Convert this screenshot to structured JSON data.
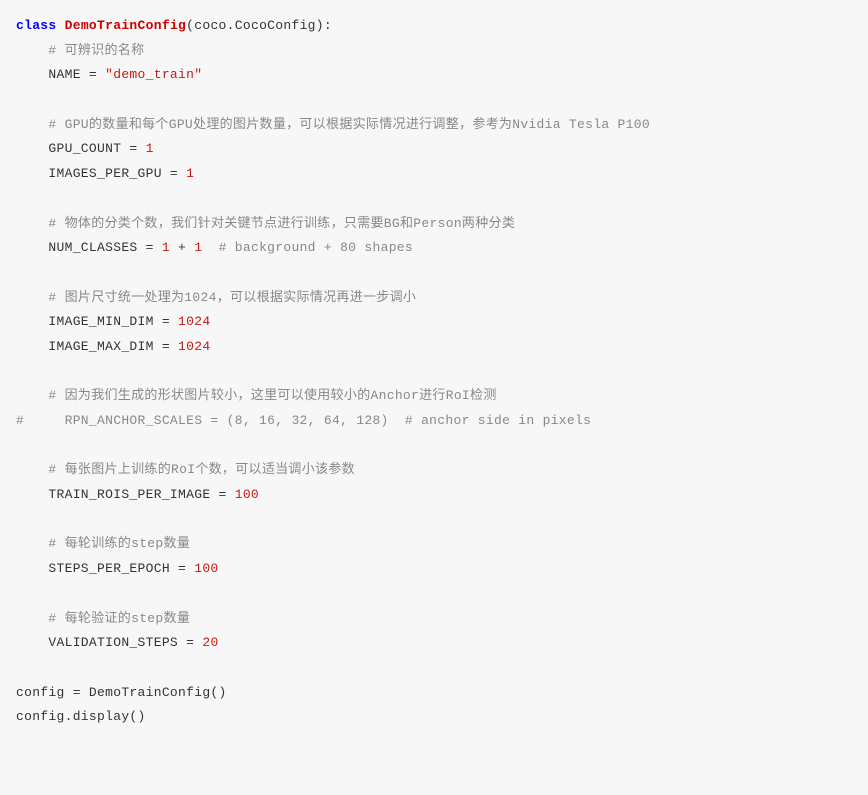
{
  "lines": [
    {
      "tokens": [
        {
          "cls": "kw",
          "text": "class"
        },
        {
          "cls": "ident",
          "text": " "
        },
        {
          "cls": "cls",
          "text": "DemoTrainConfig"
        },
        {
          "cls": "paren",
          "text": "(coco.CocoConfig):"
        }
      ]
    },
    {
      "tokens": [
        {
          "cls": "ident",
          "text": "    "
        },
        {
          "cls": "comment",
          "text": "# 可辨识的名称"
        }
      ]
    },
    {
      "tokens": [
        {
          "cls": "ident",
          "text": "    NAME = "
        },
        {
          "cls": "str",
          "text": "\"demo_train\""
        }
      ]
    },
    {
      "blank": true
    },
    {
      "tokens": [
        {
          "cls": "ident",
          "text": "    "
        },
        {
          "cls": "comment",
          "text": "# GPU的数量和每个GPU处理的图片数量，可以根据实际情况进行调整，参考为Nvidia Tesla P100"
        }
      ]
    },
    {
      "tokens": [
        {
          "cls": "ident",
          "text": "    GPU_COUNT = "
        },
        {
          "cls": "num",
          "text": "1"
        }
      ]
    },
    {
      "tokens": [
        {
          "cls": "ident",
          "text": "    IMAGES_PER_GPU = "
        },
        {
          "cls": "num",
          "text": "1"
        }
      ]
    },
    {
      "blank": true
    },
    {
      "tokens": [
        {
          "cls": "ident",
          "text": "    "
        },
        {
          "cls": "comment",
          "text": "# 物体的分类个数，我们针对关键节点进行训练，只需要BG和Person两种分类"
        }
      ]
    },
    {
      "tokens": [
        {
          "cls": "ident",
          "text": "    NUM_CLASSES = "
        },
        {
          "cls": "num",
          "text": "1"
        },
        {
          "cls": "ident",
          "text": " + "
        },
        {
          "cls": "num",
          "text": "1"
        },
        {
          "cls": "ident",
          "text": "  "
        },
        {
          "cls": "comment",
          "text": "# background + 80 shapes"
        }
      ]
    },
    {
      "blank": true
    },
    {
      "tokens": [
        {
          "cls": "ident",
          "text": "    "
        },
        {
          "cls": "comment",
          "text": "# 图片尺寸统一处理为1024，可以根据实际情况再进一步调小"
        }
      ]
    },
    {
      "tokens": [
        {
          "cls": "ident",
          "text": "    IMAGE_MIN_DIM = "
        },
        {
          "cls": "num",
          "text": "1024"
        }
      ]
    },
    {
      "tokens": [
        {
          "cls": "ident",
          "text": "    IMAGE_MAX_DIM = "
        },
        {
          "cls": "num",
          "text": "1024"
        }
      ]
    },
    {
      "blank": true
    },
    {
      "tokens": [
        {
          "cls": "ident",
          "text": "    "
        },
        {
          "cls": "comment",
          "text": "# 因为我们生成的形状图片较小，这里可以使用较小的Anchor进行RoI检测"
        }
      ]
    },
    {
      "tokens": [
        {
          "cls": "comment",
          "text": "#     RPN_ANCHOR_SCALES = (8, 16, 32, 64, 128)  # anchor side in pixels"
        }
      ]
    },
    {
      "blank": true
    },
    {
      "tokens": [
        {
          "cls": "ident",
          "text": "    "
        },
        {
          "cls": "comment",
          "text": "# 每张图片上训练的RoI个数，可以适当调小该参数"
        }
      ]
    },
    {
      "tokens": [
        {
          "cls": "ident",
          "text": "    TRAIN_ROIS_PER_IMAGE = "
        },
        {
          "cls": "num",
          "text": "100"
        }
      ]
    },
    {
      "blank": true
    },
    {
      "tokens": [
        {
          "cls": "ident",
          "text": "    "
        },
        {
          "cls": "comment",
          "text": "# 每轮训练的step数量"
        }
      ]
    },
    {
      "tokens": [
        {
          "cls": "ident",
          "text": "    STEPS_PER_EPOCH = "
        },
        {
          "cls": "num",
          "text": "100"
        }
      ]
    },
    {
      "blank": true
    },
    {
      "tokens": [
        {
          "cls": "ident",
          "text": "    "
        },
        {
          "cls": "comment",
          "text": "# 每轮验证的step数量"
        }
      ]
    },
    {
      "tokens": [
        {
          "cls": "ident",
          "text": "    VALIDATION_STEPS = "
        },
        {
          "cls": "num",
          "text": "20"
        }
      ]
    },
    {
      "blank": true
    },
    {
      "tokens": [
        {
          "cls": "ident",
          "text": "config = DemoTrainConfig()"
        }
      ]
    },
    {
      "tokens": [
        {
          "cls": "ident",
          "text": "config.display()"
        }
      ]
    }
  ]
}
